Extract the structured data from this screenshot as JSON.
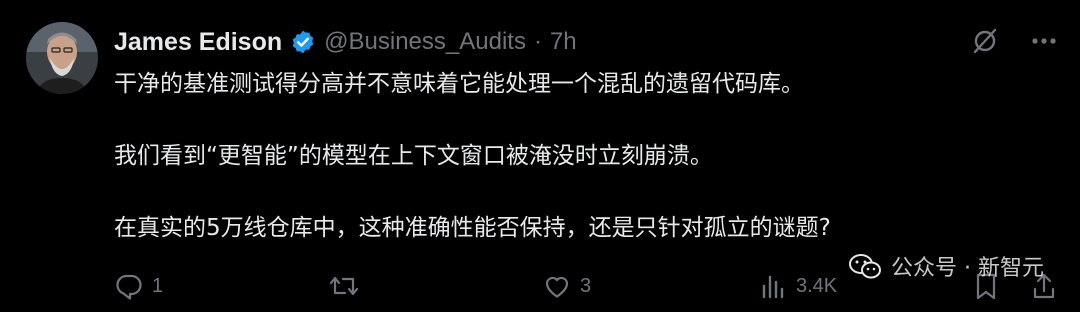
{
  "tweet": {
    "author": {
      "name": "James Edison",
      "handle": "@Business_Audits",
      "time": "7h",
      "separator": "·",
      "verified_color": "#1d9bf0"
    },
    "paragraphs": [
      "干净的基准测试得分高并不意味着它能处理一个混乱的遗留代码库。",
      "我们看到“更智能”的模型在上下文窗口被淹没时立刻崩溃。",
      "在真实的5万线仓库中，这种准确性能否保持，还是只针对孤立的谜题?"
    ],
    "top_actions": [
      {
        "icon": "grok-slash-icon"
      },
      {
        "icon": "more-horizontal-icon"
      }
    ],
    "stats": {
      "replies": "1",
      "reposts": "",
      "likes": "3",
      "views": "3.4K"
    }
  },
  "watermark": {
    "text": "公众号 · 新智元"
  },
  "colors": {
    "background": "#000000",
    "text_primary": "#e7e9ea",
    "text_secondary": "#71767b",
    "accent": "#1d9bf0"
  }
}
